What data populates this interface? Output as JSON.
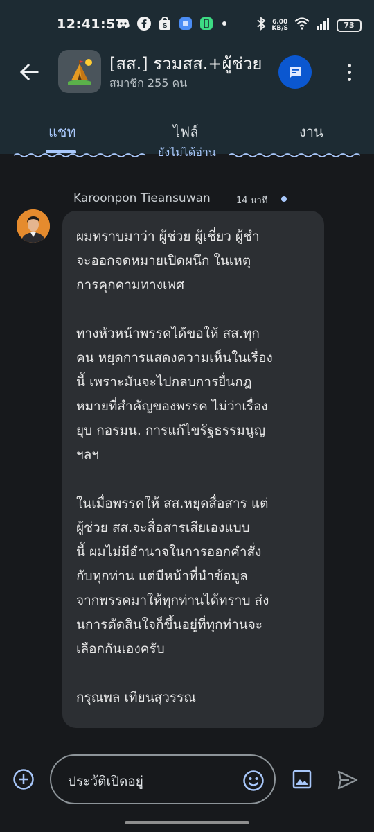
{
  "status_bar": {
    "time": "12:41:57",
    "net_speed_value": "6.00",
    "net_speed_unit": "KB/S",
    "battery": "73"
  },
  "header": {
    "title": "[สส.] รวมสส.+ผู้ช่วย",
    "subtitle": "สมาชิก 255 คน",
    "group_avatar_icon": "camping-tent-icon"
  },
  "tabs": [
    {
      "label": "แชท",
      "active": true
    },
    {
      "label": "ไฟล์",
      "active": false
    },
    {
      "label": "งาน",
      "active": false
    }
  ],
  "unread_divider": "ยังไม่ได้อ่าน",
  "message": {
    "sender": "Karoonpon Tieansuwan",
    "time": "14 นาที",
    "paragraphs": [
      "ผมทราบมาว่า ผู้ช่วย ผู้เชี่ยว ผู้ชำ\nจะออกจดหมายเปิดผนึก ในเหตุ\nการคุกคามทางเพศ",
      "ทางหัวหน้าพรรคได้ขอให้ สส.ทุก\nคน หยุดการแสดงความเห็นในเรื่อง\nนี้ เพราะมันจะไปกลบการยื่นกฎ\nหมายที่สำคัญของพรรค ไม่ว่าเรื่อง\nยุบ กอรมน. การแก้ไขรัฐธรรมนูญ\nฯลฯ",
      "ในเมื่อพรรคให้ สส.หยุดสื่อสาร แต่\nผู้ช่วย สส.จะสื่อสารเสียเองแบบ\nนี้ ผมไม่มีอำนาจในการออกคำสั่ง\nกับทุกท่าน แต่มีหน้าที่นำข้อมูล\nจากพรรคมาให้ทุกท่านได้ทราบ ส่ง\nนการตัดสินใจก็ขึ้นอยู่ที่ทุกท่านจะ\nเลือกกันเองครับ",
      "กรุณพล เทียนสุวรรณ"
    ]
  },
  "composer": {
    "placeholder": "ประวัติเปิดอยู่"
  },
  "colors": {
    "accent": "#a8c7fa",
    "fab": "#0b57d0",
    "background": "#17191c",
    "header_bg": "#1d2b33",
    "bubble_bg": "#2c2f33"
  }
}
